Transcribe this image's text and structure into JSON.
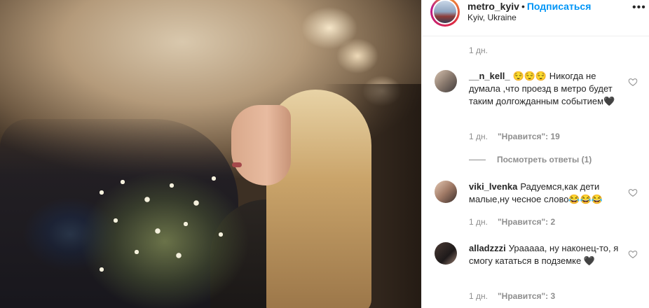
{
  "post": {
    "username": "metro_kyiv",
    "separator": "•",
    "follow_label": "Подписаться",
    "location": "Kyiv, Ukraine",
    "more_icon": "more-horizontal-icon",
    "time": "1 дн."
  },
  "comments": [
    {
      "username": "__n_kell_",
      "text": "😌😌😌 Никогда не думала ,что проезд в метро будет таким долгожданным событием🖤",
      "time": "1 дн.",
      "likes": "\"Нравится\": 19"
    },
    {
      "username": "viki_lvenka",
      "text": "Радуемся,как дети малые,ну чесное слово😂😂😂",
      "time": "1 дн.",
      "likes": "\"Нравится\": 2"
    },
    {
      "username": "alladzzzi",
      "text": "Урааааа, ну наконец-то, я смогу кататься в подземке 🖤",
      "time": "1 дн.",
      "likes": "\"Нравится\": 3"
    }
  ],
  "view_replies_label": "Посмотреть ответы (1)",
  "colors": {
    "accent": "#0095f6",
    "text": "#262626",
    "muted": "#8e8e8e"
  }
}
